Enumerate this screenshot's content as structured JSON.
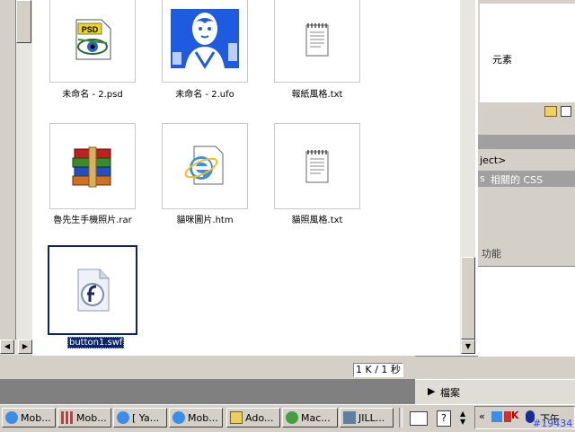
{
  "files": [
    {
      "name": "未命名 - 2.psd",
      "icon": "psd-file-icon",
      "badge": "PSD"
    },
    {
      "name": "未命名 - 2.ufo",
      "icon": "portrait-thumbnail-icon"
    },
    {
      "name": "報紙風格.txt",
      "icon": "notepad-icon"
    },
    {
      "name": "魯先生手機照片.rar",
      "icon": "winrar-archive-icon"
    },
    {
      "name": "貓咪圖片.htm",
      "icon": "ie-document-icon"
    },
    {
      "name": "貓照風格.txt",
      "icon": "notepad-icon"
    },
    {
      "name": "button1.swf",
      "icon": "flash-file-icon"
    }
  ],
  "status": {
    "size": "1 K / 1 秒"
  },
  "right_panel": {
    "tree_text": "元素",
    "project_text": "ject>",
    "tab_related_css": "相關的 CSS",
    "tab_prefix": "s",
    "section_function": "功能",
    "files_panel_label": "檔案"
  },
  "taskbar": {
    "buttons": [
      {
        "label": "Mob...",
        "icon": "ie-icon"
      },
      {
        "label": "Mob...",
        "icon": "grid-app-icon"
      },
      {
        "label": "[ Ya...",
        "icon": "ie-icon"
      },
      {
        "label": "Mob...",
        "icon": "ie-icon"
      },
      {
        "label": "Ado...",
        "icon": "acrobat-icon"
      },
      {
        "label": "Mac...",
        "icon": "macromedia-icon"
      },
      {
        "label": "JILL...",
        "icon": "tool-icon"
      }
    ],
    "tray": {
      "clock": "下午",
      "overlay": "#19434"
    }
  },
  "colors": {
    "selection": "#0a246a",
    "window": "#ffffff",
    "chrome": "#d4d0c8"
  }
}
